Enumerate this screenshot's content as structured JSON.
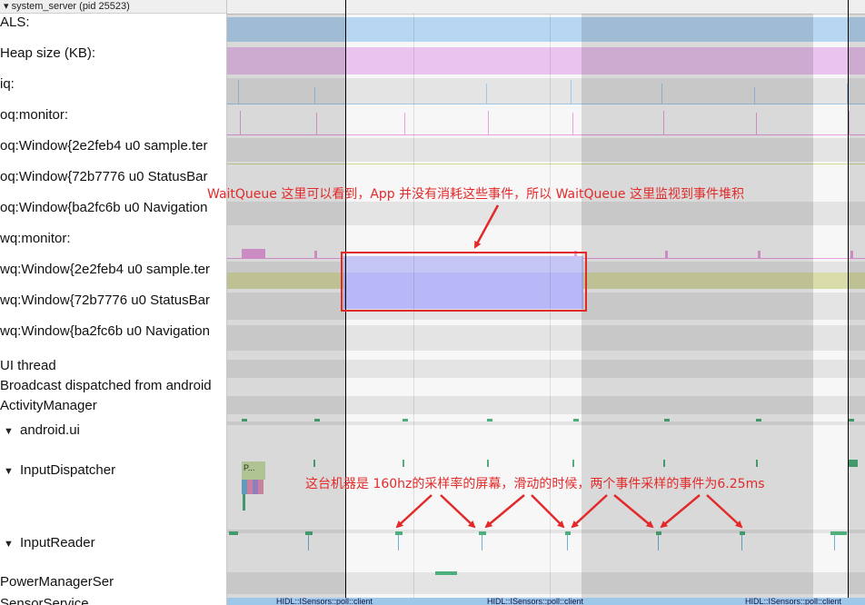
{
  "process_header": "▾ system_server (pid 25523)",
  "tracks": [
    {
      "label": "ALS:"
    },
    {
      "label": "Heap size (KB):"
    },
    {
      "label": "iq:"
    },
    {
      "label": "oq:monitor:"
    },
    {
      "label": "oq:Window{2e2feb4 u0 sample.ter"
    },
    {
      "label": "oq:Window{72b7776 u0 StatusBar"
    },
    {
      "label": "oq:Window{ba2fc6b u0 Navigation"
    },
    {
      "label": "wq:monitor:"
    },
    {
      "label": "wq:Window{2e2feb4 u0 sample.ter"
    },
    {
      "label": "wq:Window{72b7776 u0 StatusBar"
    },
    {
      "label": "wq:Window{ba2fc6b u0 Navigation"
    },
    {
      "label": "UI thread"
    },
    {
      "label": "Broadcast dispatched from android"
    },
    {
      "label": "ActivityManager"
    },
    {
      "label": "android.ui",
      "twisty": "▼"
    },
    {
      "label": "InputDispatcher",
      "twisty": "▼"
    },
    {
      "label": "InputReader",
      "twisty": "▼"
    },
    {
      "label": "PowerManagerSer"
    },
    {
      "label": "SensorService"
    }
  ],
  "slice_labels": {
    "input_dispatcher_slice": "P...",
    "bottom_1": "HIDL::ISensors::poll::client",
    "bottom_2": "HIDL::ISensors::poll::client",
    "bottom_3": "HIDL::ISensors::poll::client"
  },
  "annotations": {
    "waitqueue": "WaitQueue 这里可以看到，App 并没有消耗这些事件，所以 WaitQueue 这里监视到事件堆积",
    "sampling": "这台机器是 160hz的采样率的屏幕，滑动的时候，两个事件采样的事件为6.25ms"
  },
  "colors": {
    "annotation_red": "#e32a2a",
    "als_track": "#b7d6f2",
    "heap_track": "#eac3ee",
    "wq_highlight": "#b8b8f8",
    "input_slice": "#4daf7c"
  }
}
